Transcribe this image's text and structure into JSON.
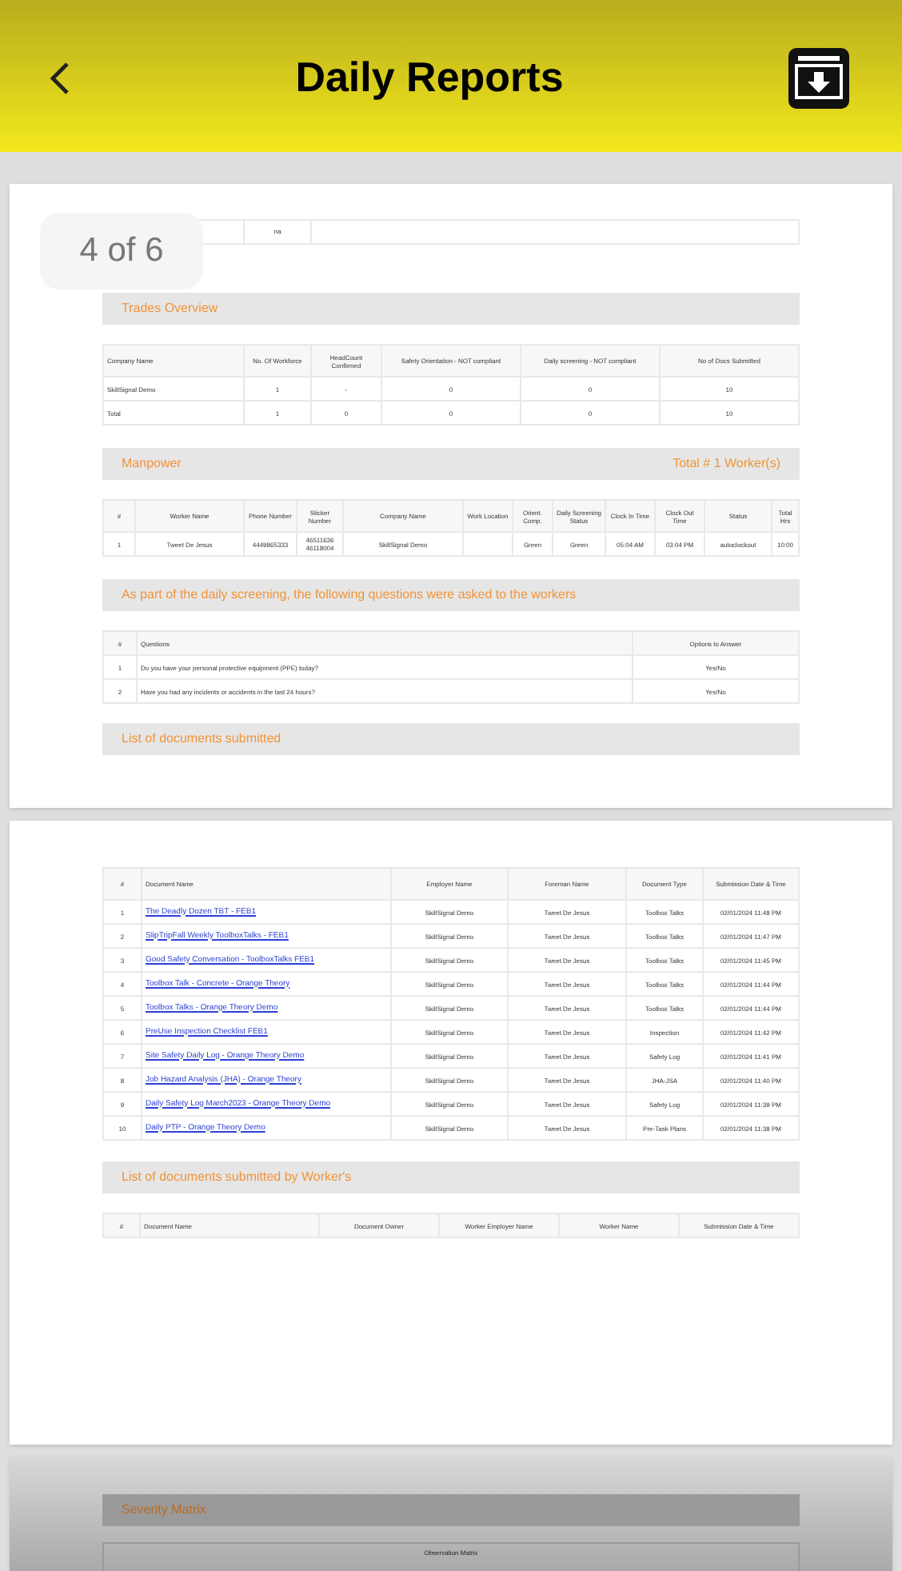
{
  "header": {
    "title": "Daily Reports"
  },
  "page_indicator": "4 of 6",
  "top_row": {
    "value": "na"
  },
  "trades": {
    "title": "Trades Overview",
    "columns": [
      "Company Name",
      "No. Of Workforce",
      "HeadCount Confirmed",
      "Safety Orientation - NOT compliant",
      "Daily screening - NOT compliant",
      "No of Docs Submitted"
    ],
    "rows": [
      [
        "SkillSignal Demo",
        "1",
        "-",
        "0",
        "0",
        "10"
      ],
      [
        "Total",
        "1",
        "0",
        "0",
        "0",
        "10"
      ]
    ]
  },
  "manpower": {
    "title": "Manpower",
    "total": "Total # 1 Worker(s)",
    "columns": [
      "#",
      "Worker Name",
      "Phone Number",
      "Sticker Number",
      "Company Name",
      "Work Location",
      "Orient. Comp.",
      "Daily Screening Status",
      "Clock In Time",
      "Clock Out Time",
      "Status",
      "Total Hrs"
    ],
    "rows": [
      [
        "1",
        "Tweet De Jesus",
        "4449865333",
        "46511636 46118004",
        "SkillSignal Demo",
        "",
        "Green",
        "Green",
        "05:04 AM",
        "03:04 PM",
        "autoclockout",
        "10:00"
      ]
    ]
  },
  "screening": {
    "title": "As part of the daily screening, the following questions were asked to the workers",
    "columns": [
      "#",
      "Questions",
      "Options to Answer"
    ],
    "rows": [
      [
        "1",
        "Do you have your personal protective equipment (PPE) today?",
        "Yes/No"
      ],
      [
        "2",
        "Have you had any incidents or accidents in the last 24 hours?",
        "Yes/No"
      ]
    ]
  },
  "documents": {
    "title": "List of documents submitted",
    "columns": [
      "#",
      "Document Name",
      "Employer Name",
      "Foreman Name",
      "Document Type",
      "Submission Date & Time"
    ],
    "rows": [
      [
        "1",
        "The Deadly Dozen TBT - FEB1",
        "SkillSignal Demo",
        "Tweet De Jesus",
        "Toolbox Talks",
        "02/01/2024 11:48 PM"
      ],
      [
        "2",
        "SlipTripFall Weekly ToolboxTalks - FEB1",
        "SkillSignal Demo",
        "Tweet De Jesus",
        "Toolbox Talks",
        "02/01/2024 11:47 PM"
      ],
      [
        "3",
        "Good Safety Conversation - ToolboxTalks FEB1",
        "SkillSignal Demo",
        "Tweet De Jesus",
        "Toolbox Talks",
        "02/01/2024 11:45 PM"
      ],
      [
        "4",
        "Toolbox Talk - Concrete - Orange Theory",
        "SkillSignal Demo",
        "Tweet De Jesus",
        "Toolbox Talks",
        "02/01/2024 11:44 PM"
      ],
      [
        "5",
        "Toolbox Talks - Orange Theory Demo",
        "SkillSignal Demo",
        "Tweet De Jesus",
        "Toolbox Talks",
        "02/01/2024 11:44 PM"
      ],
      [
        "6",
        "PreUse Inspection Checklist FEB1",
        "SkillSignal Demo",
        "Tweet De Jesus",
        "Inspection",
        "02/01/2024 11:42 PM"
      ],
      [
        "7",
        "Site Safety Daily Log - Orange Theory Demo",
        "SkillSignal Demo",
        "Tweet De Jesus",
        "Safety Log",
        "02/01/2024 11:41 PM"
      ],
      [
        "8",
        "Job Hazard Analysis (JHA) - Orange Theory",
        "SkillSignal Demo",
        "Tweet De Jesus",
        "JHA-JSA",
        "02/01/2024 11:40 PM"
      ],
      [
        "9",
        "Daily Safety Log March2023 - Orange Theory Demo",
        "SkillSignal Demo",
        "Tweet De Jesus",
        "Safety Log",
        "02/01/2024 11:39 PM"
      ],
      [
        "10",
        "Daily PTP - Orange Theory Demo",
        "SkillSignal Demo",
        "Tweet De Jesus",
        "Pre-Task Plans",
        "02/01/2024 11:38 PM"
      ]
    ]
  },
  "worker_documents": {
    "title": "List of documents submitted by Worker's",
    "columns": [
      "#",
      "Document Name",
      "Document Owner",
      "Worker Employer Name",
      "Worker Name",
      "Submission Date & Time"
    ]
  },
  "severity": {
    "title": "Severity Matrix",
    "columns": [
      "Observation Matrix"
    ]
  }
}
